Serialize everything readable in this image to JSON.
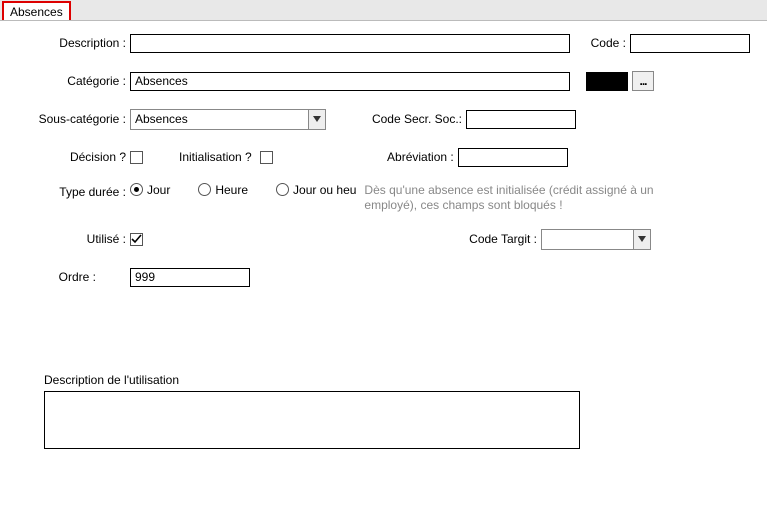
{
  "tabs": {
    "active": "Absences"
  },
  "labels": {
    "description": "Description :",
    "code": "Code :",
    "categorie": "Catégorie :",
    "sousCategorie": "Sous-catégorie :",
    "codeSecrSoc": "Code Secr. Soc.:",
    "decision": "Décision ?",
    "initialisation": "Initialisation ?",
    "abreviation": "Abréviation :",
    "typeDuree": "Type durée :",
    "utilise": "Utilisé :",
    "codeTargit": "Code Targit :",
    "ordre": "Ordre :",
    "descUtil": "Description de l'utilisation"
  },
  "values": {
    "description": "",
    "code": "",
    "categorie": "Absences",
    "sousCategorie": "Absences",
    "codeSecrSoc": "",
    "decision": false,
    "initialisation": false,
    "abreviation": "",
    "typeDuree": "Jour",
    "utilise": true,
    "codeTargit": "",
    "ordre": "999",
    "descUtil": "",
    "color": "#000000"
  },
  "radios": {
    "jour": "Jour",
    "heure": "Heure",
    "jourOuHeure": "Jour ou heu"
  },
  "hint": "Dès qu'une absence est initialisée (crédit assigné à un employé), ces champs sont bloqués !",
  "ellipsis": "..."
}
